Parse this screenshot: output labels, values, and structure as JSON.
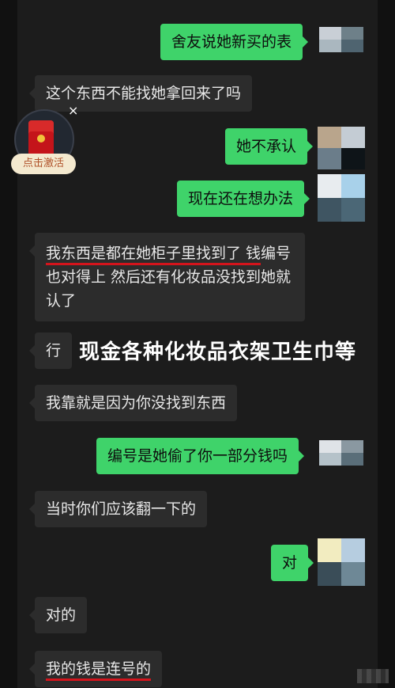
{
  "messages": [
    {
      "id": "m1",
      "side": "sent",
      "text": "舍友说她新买的表"
    },
    {
      "id": "m2",
      "side": "recv",
      "text": "这个东西不能找她拿回来了吗"
    },
    {
      "id": "m3",
      "side": "sent",
      "text": "她不承认"
    },
    {
      "id": "m4",
      "side": "sent",
      "text": "现在还在想办法"
    },
    {
      "id": "m5",
      "side": "recv",
      "text_underlined": "我东西是都在她柜子里找到了 钱",
      "text_rest": "编号也对得上 然后还有化妆品没找到她就认了"
    },
    {
      "id": "m6",
      "side": "recv",
      "text": "行"
    },
    {
      "id": "m7",
      "side": "recv",
      "text": "我靠就是因为你没找到东西"
    },
    {
      "id": "m8",
      "side": "sent",
      "text": "编号是她偷了你一部分钱吗"
    },
    {
      "id": "m9",
      "side": "recv",
      "text": "当时你们应该翻一下的"
    },
    {
      "id": "m10",
      "side": "sent",
      "text": "对"
    },
    {
      "id": "m11",
      "side": "recv",
      "text": "对的"
    },
    {
      "id": "m12",
      "side": "recv",
      "text": "我的钱是连号的"
    }
  ],
  "overlay_caption": "现金各种化妆品衣架卫生巾等",
  "promo": {
    "label": "点击激活",
    "close": "×"
  },
  "colors": {
    "background": "#1c1c1c",
    "sent_bubble": "#3fd36a",
    "recv_bubble": "#2c2c2c",
    "underline": "#d4141c"
  }
}
